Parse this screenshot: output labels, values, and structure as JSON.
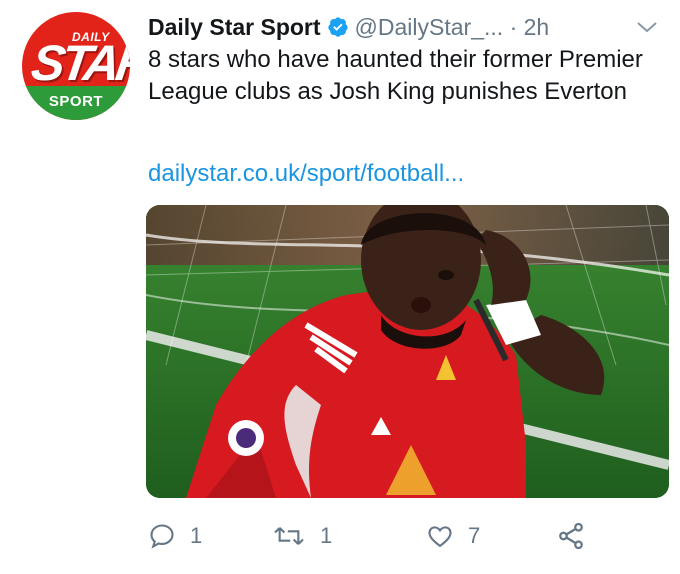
{
  "account": {
    "avatar_text_top": "DAILY",
    "avatar_text_main": "STAR",
    "avatar_text_bottom": "SPORT",
    "name": "Daily Star Sport",
    "handle": "@DailyStar_...",
    "time": "· 2h"
  },
  "tweet": {
    "text": "8 stars who have haunted their former Premier League clubs as Josh King punishes Everton",
    "link": "dailystar.co.uk/sport/football..."
  },
  "actions": {
    "reply_count": "1",
    "retweet_count": "1",
    "like_count": "7"
  },
  "colors": {
    "link": "#1b95e0",
    "muted": "#657786",
    "verified": "#1da1f2",
    "brand_red": "#e2231a",
    "brand_green": "#2e9b3a"
  }
}
